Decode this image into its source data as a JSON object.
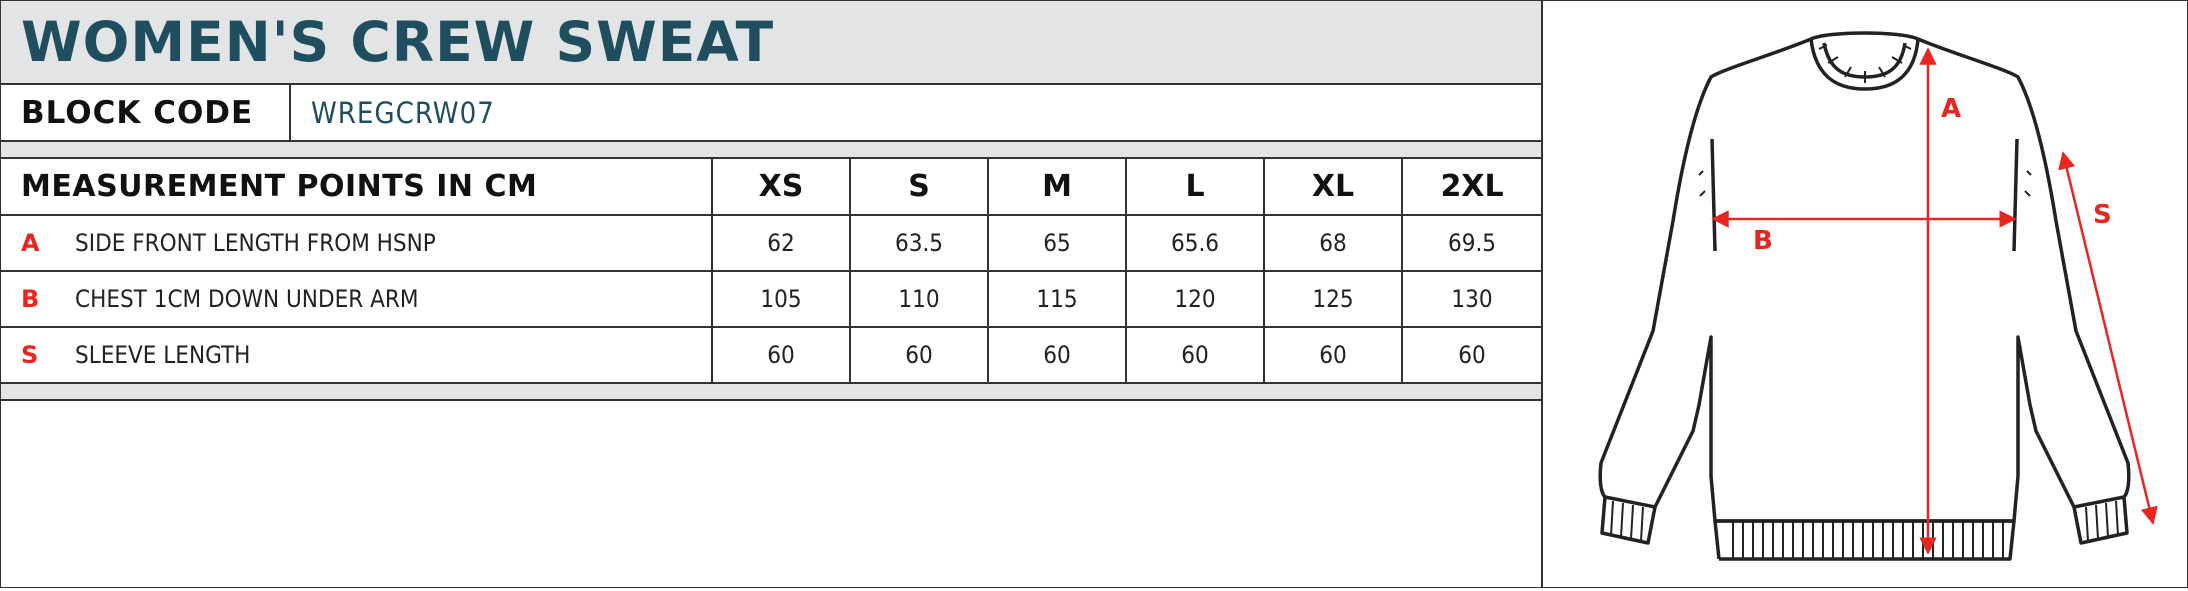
{
  "title": "WOMEN'S CREW SWEAT",
  "block": {
    "label": "BLOCK CODE",
    "value": "WREGCRW07"
  },
  "table": {
    "header": "MEASUREMENT POINTS IN CM",
    "sizes": [
      "XS",
      "S",
      "M",
      "L",
      "XL",
      "2XL"
    ],
    "rows": [
      {
        "code": "A",
        "label": "SIDE FRONT LENGTH FROM HSNP",
        "values": [
          "62",
          "63.5",
          "65",
          "65.6",
          "68",
          "69.5"
        ]
      },
      {
        "code": "B",
        "label": "CHEST 1CM DOWN UNDER ARM",
        "values": [
          "105",
          "110",
          "115",
          "120",
          "125",
          "130"
        ]
      },
      {
        "code": "S",
        "label": "SLEEVE LENGTH",
        "values": [
          "60",
          "60",
          "60",
          "60",
          "60",
          "60"
        ]
      }
    ]
  },
  "diagram": {
    "labels": {
      "a": "A",
      "b": "B",
      "s": "S"
    }
  },
  "colors": {
    "title": "#1f4e5f",
    "accent": "#e8251f",
    "band": "#e3e4e6"
  }
}
